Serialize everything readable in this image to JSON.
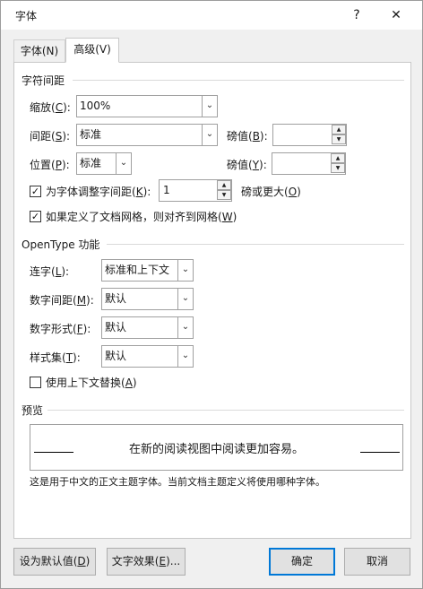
{
  "dialog": {
    "title": "字体",
    "help_label": "?",
    "close_label": "✕"
  },
  "tabs": [
    {
      "label": "字体(N)",
      "active": false
    },
    {
      "label": "高级(V)",
      "active": true
    }
  ],
  "char_spacing": {
    "section": "字符间距",
    "scale": {
      "label_pre": "缩放(",
      "key": "C",
      "label_post": "):",
      "value": "100%"
    },
    "spacing": {
      "label_pre": "间距(",
      "key": "S",
      "label_post": "):",
      "value": "标准"
    },
    "spacing_pt": {
      "label_pre": "磅值(",
      "key": "B",
      "label_post": "):",
      "value": ""
    },
    "position": {
      "label_pre": "位置(",
      "key": "P",
      "label_post": "):",
      "value": "标准"
    },
    "position_pt": {
      "label_pre": "磅值(",
      "key": "Y",
      "label_post": "):",
      "value": ""
    },
    "kerning": {
      "checked": true,
      "label_pre": "为字体调整字间距(",
      "key": "K",
      "label_post": "):",
      "value": "1",
      "suffix_pre": "磅或更大(",
      "suffix_key": "O",
      "suffix_post": ")"
    },
    "grid": {
      "checked": true,
      "label_pre": "如果定义了文档网格，则对齐到网格(",
      "key": "W",
      "label_post": ")"
    }
  },
  "opentype": {
    "section": "OpenType 功能",
    "ligatures": {
      "label_pre": "连字(",
      "key": "L",
      "label_post": "):",
      "value": "标准和上下文"
    },
    "num_spacing": {
      "label_pre": "数字间距(",
      "key": "M",
      "label_post": "):",
      "value": "默认"
    },
    "num_form": {
      "label_pre": "数字形式(",
      "key": "F",
      "label_post": "):",
      "value": "默认"
    },
    "style_set": {
      "label_pre": "样式集(",
      "key": "T",
      "label_post": "):",
      "value": "默认"
    },
    "contextual": {
      "checked": false,
      "label_pre": "使用上下文替换(",
      "key": "A",
      "label_post": ")"
    }
  },
  "preview": {
    "section": "预览",
    "sample": "在新的阅读视图中阅读更加容易。",
    "note": "这是用于中文的正文主题字体。当前文档主题定义将使用哪种字体。"
  },
  "buttons": {
    "set_default": {
      "label_pre": "设为默认值(",
      "key": "D",
      "label_post": ")"
    },
    "text_effects": {
      "label_pre": "文字效果(",
      "key": "E",
      "label_post": ")..."
    },
    "ok": "确定",
    "cancel": "取消"
  },
  "colors": {
    "accent": "#0078d7",
    "highlight": "#ffff00"
  }
}
